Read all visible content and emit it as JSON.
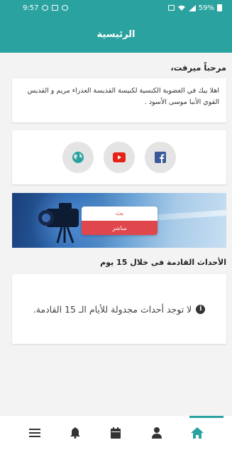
{
  "status_bar": {
    "time": "9:57",
    "battery_percent": "59%",
    "left_icons": [
      "location-icon",
      "image-icon",
      "record-icon"
    ],
    "right_icons": [
      "alarm-icon",
      "wifi-icon",
      "signal-icon",
      "battery-icon"
    ]
  },
  "header": {
    "title": "الرئيسية"
  },
  "welcome": {
    "text": "مرحباً ميرفت،"
  },
  "message": {
    "text": "اهلا بيك في العضوية الكنسية لكنيسة القديسة العذراء مريم و القديس القوي الأنبا موسى الأسود ."
  },
  "social": {
    "icons": [
      "facebook-icon",
      "youtube-icon",
      "globe-icon"
    ]
  },
  "live": {
    "top_label": "بث",
    "bottom_label": "مباشر"
  },
  "events": {
    "title_prefix": "الأحداث القادمة فى خلال",
    "title_days": "15",
    "title_suffix": "يوم",
    "empty_text": "لا توجد أحداث مجدولة للأيام الـ 15 القادمة."
  },
  "bottom_nav": {
    "items": [
      "home-icon",
      "person-icon",
      "calendar-icon",
      "bell-icon",
      "menu-icon"
    ],
    "active": "home-icon"
  },
  "colors": {
    "primary": "#2aa3a0",
    "live_red": "#e0474c",
    "facebook": "#3b5998",
    "youtube": "#e62117",
    "globe": "#2aa3a0"
  }
}
